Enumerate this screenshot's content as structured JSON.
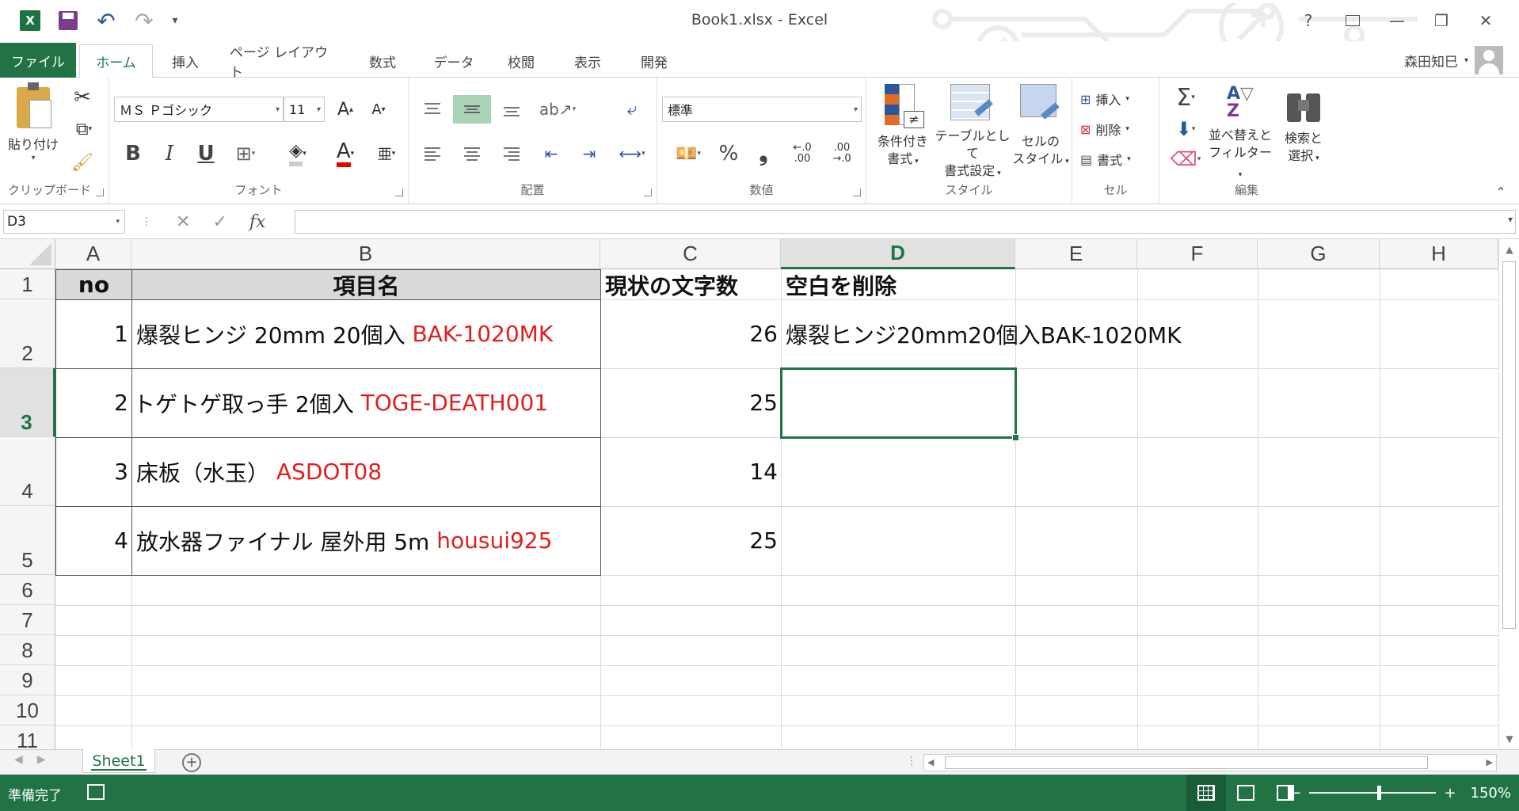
{
  "window": {
    "title": "Book1.xlsx - Excel"
  },
  "qat": {
    "customize": "▾"
  },
  "tabs": [
    "ファイル",
    "ホーム",
    "挿入",
    "ページ レイアウト",
    "数式",
    "データ",
    "校閲",
    "表示",
    "開発"
  ],
  "user": {
    "name": "森田知巳"
  },
  "ribbon": {
    "clipboard": {
      "label": "クリップボード",
      "paste": "貼り付け"
    },
    "font": {
      "label": "フォント",
      "name": "ＭＳ Ｐゴシック",
      "size": "11",
      "bold": "B",
      "italic": "I",
      "underline": "U",
      "font_color": "A",
      "phonetic": "亜",
      "grow": "A",
      "shrink": "A"
    },
    "alignment": {
      "label": "配置"
    },
    "number": {
      "label": "数値",
      "format": "標準",
      "percent": "%",
      "comma": "❟",
      "inc_decimal": "←.0 .00",
      "dec_decimal": ".00 →.0"
    },
    "styles": {
      "label": "スタイル",
      "conditional": [
        "条件付き",
        "書式"
      ],
      "table": [
        "テーブルとして",
        "書式設定"
      ],
      "cell_styles": [
        "セルの",
        "スタイル"
      ]
    },
    "cells": {
      "label": "セル",
      "insert": "挿入",
      "delete": "削除",
      "format": "書式"
    },
    "editing": {
      "label": "編集",
      "sort": [
        "並べ替えと",
        "フィルター"
      ],
      "find": [
        "検索と",
        "選択"
      ]
    }
  },
  "formula_bar": {
    "name_box": "D3",
    "fx": "fx",
    "cancel": "✕",
    "enter": "✓",
    "value": ""
  },
  "columns": [
    "A",
    "B",
    "C",
    "D",
    "E",
    "F",
    "G",
    "H"
  ],
  "rows": [
    "1",
    "2",
    "3",
    "4",
    "5",
    "6",
    "7",
    "8",
    "9",
    "10",
    "11"
  ],
  "selected": {
    "column": "D",
    "row": "3"
  },
  "table": {
    "headers": {
      "a": "no",
      "b": "項目名",
      "c": "現状の文字数",
      "d": "空白を削除"
    },
    "rows": [
      {
        "no": "1",
        "name": "爆裂ヒンジ 20mm 20個入 ",
        "code": "BAK-1020MK",
        "count": "26",
        "result": "爆裂ヒンジ20mm20個入BAK-1020MK"
      },
      {
        "no": "2",
        "name": "トゲトゲ取っ手 2個入 ",
        "code": "TOGE-DEATH001",
        "count": "25",
        "result": ""
      },
      {
        "no": "3",
        "name": "床板（水玉） ",
        "code": "ASDOT08",
        "count": "14",
        "result": ""
      },
      {
        "no": "4",
        "name": "放水器ファイナル 屋外用 5m ",
        "code": "housui925",
        "count": "25",
        "result": ""
      }
    ]
  },
  "sheets": {
    "active": "Sheet1",
    "add": "+"
  },
  "status": {
    "ready": "準備完了",
    "zoom": "150%",
    "zoom_out": "−",
    "zoom_in": "+"
  },
  "colors": {
    "accent": "#217346",
    "code_text": "#e02020"
  }
}
